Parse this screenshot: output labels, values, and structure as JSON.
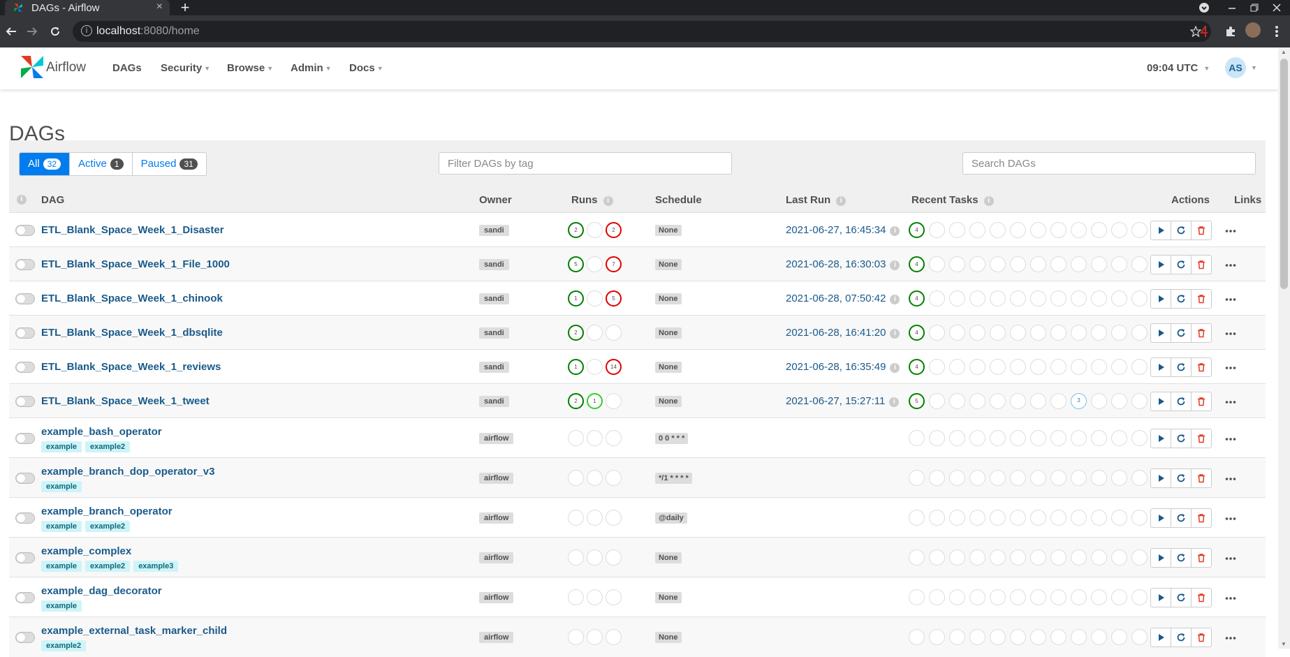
{
  "browser": {
    "tab_title": "DAGs - Airflow",
    "tab_close": "×",
    "new_tab": "+",
    "url_host": "localhost",
    "url_rest": ":8080/home"
  },
  "navbar": {
    "brand": "Airflow",
    "items": [
      {
        "label": "DAGs",
        "dropdown": false
      },
      {
        "label": "Security",
        "dropdown": true
      },
      {
        "label": "Browse",
        "dropdown": true
      },
      {
        "label": "Admin",
        "dropdown": true
      },
      {
        "label": "Docs",
        "dropdown": true
      }
    ],
    "clock": "09:04 UTC",
    "avatar": "AS"
  },
  "page": {
    "title": "DAGs",
    "filters": {
      "all_label": "All",
      "all_count": "32",
      "active_label": "Active",
      "active_count": "1",
      "paused_label": "Paused",
      "paused_count": "31"
    },
    "tag_filter_placeholder": "Filter DAGs by tag",
    "search_placeholder": "Search DAGs"
  },
  "table": {
    "headers": {
      "dag": "DAG",
      "owner": "Owner",
      "runs": "Runs",
      "schedule": "Schedule",
      "last_run": "Last Run",
      "recent_tasks": "Recent Tasks",
      "actions": "Actions",
      "links": "Links"
    },
    "rows": [
      {
        "name": "ETL_Blank_Space_Week_1_Disaster",
        "tags": [],
        "owner": "sandi",
        "runs": [
          {
            "s": "success",
            "n": "2"
          },
          {
            "s": "empty",
            "n": ""
          },
          {
            "s": "failed",
            "n": "2"
          }
        ],
        "schedule": "None",
        "last_run": "2021-06-27, 16:45:34",
        "tasks": {
          "0": {
            "s": "success",
            "n": "4"
          }
        }
      },
      {
        "name": "ETL_Blank_Space_Week_1_File_1000",
        "tags": [],
        "owner": "sandi",
        "runs": [
          {
            "s": "success",
            "n": "5"
          },
          {
            "s": "empty",
            "n": ""
          },
          {
            "s": "failed",
            "n": "7"
          }
        ],
        "schedule": "None",
        "last_run": "2021-06-28, 16:30:03",
        "tasks": {
          "0": {
            "s": "success",
            "n": "4"
          }
        }
      },
      {
        "name": "ETL_Blank_Space_Week_1_chinook",
        "tags": [],
        "owner": "sandi",
        "runs": [
          {
            "s": "success",
            "n": "1"
          },
          {
            "s": "empty",
            "n": ""
          },
          {
            "s": "failed",
            "n": "5"
          }
        ],
        "schedule": "None",
        "last_run": "2021-06-28, 07:50:42",
        "tasks": {
          "0": {
            "s": "success",
            "n": "4"
          }
        }
      },
      {
        "name": "ETL_Blank_Space_Week_1_dbsqlite",
        "tags": [],
        "owner": "sandi",
        "runs": [
          {
            "s": "success",
            "n": "2"
          },
          {
            "s": "empty",
            "n": ""
          },
          {
            "s": "empty",
            "n": ""
          }
        ],
        "schedule": "None",
        "last_run": "2021-06-28, 16:41:20",
        "tasks": {
          "0": {
            "s": "success",
            "n": "4"
          }
        }
      },
      {
        "name": "ETL_Blank_Space_Week_1_reviews",
        "tags": [],
        "owner": "sandi",
        "runs": [
          {
            "s": "success",
            "n": "1"
          },
          {
            "s": "empty",
            "n": ""
          },
          {
            "s": "failed",
            "n": "14"
          }
        ],
        "schedule": "None",
        "last_run": "2021-06-28, 16:35:49",
        "tasks": {
          "0": {
            "s": "success",
            "n": "4"
          }
        }
      },
      {
        "name": "ETL_Blank_Space_Week_1_tweet",
        "tags": [],
        "owner": "sandi",
        "runs": [
          {
            "s": "success",
            "n": "2"
          },
          {
            "s": "running",
            "n": "1"
          },
          {
            "s": "empty",
            "n": ""
          }
        ],
        "schedule": "None",
        "last_run": "2021-06-27, 15:27:11",
        "tasks": {
          "0": {
            "s": "success",
            "n": "5"
          },
          "8": {
            "s": "queued",
            "n": "3"
          }
        }
      },
      {
        "name": "example_bash_operator",
        "tags": [
          "example",
          "example2"
        ],
        "owner": "airflow",
        "runs": [
          {
            "s": "empty",
            "n": ""
          },
          {
            "s": "empty",
            "n": ""
          },
          {
            "s": "empty",
            "n": ""
          }
        ],
        "schedule": "0 0 * * *",
        "last_run": "",
        "tasks": {}
      },
      {
        "name": "example_branch_dop_operator_v3",
        "tags": [
          "example"
        ],
        "owner": "airflow",
        "runs": [
          {
            "s": "empty",
            "n": ""
          },
          {
            "s": "empty",
            "n": ""
          },
          {
            "s": "empty",
            "n": ""
          }
        ],
        "schedule": "*/1 * * * *",
        "last_run": "",
        "tasks": {}
      },
      {
        "name": "example_branch_operator",
        "tags": [
          "example",
          "example2"
        ],
        "owner": "airflow",
        "runs": [
          {
            "s": "empty",
            "n": ""
          },
          {
            "s": "empty",
            "n": ""
          },
          {
            "s": "empty",
            "n": ""
          }
        ],
        "schedule": "@daily",
        "last_run": "",
        "tasks": {}
      },
      {
        "name": "example_complex",
        "tags": [
          "example",
          "example2",
          "example3"
        ],
        "owner": "airflow",
        "runs": [
          {
            "s": "empty",
            "n": ""
          },
          {
            "s": "empty",
            "n": ""
          },
          {
            "s": "empty",
            "n": ""
          }
        ],
        "schedule": "None",
        "last_run": "",
        "tasks": {}
      },
      {
        "name": "example_dag_decorator",
        "tags": [
          "example"
        ],
        "owner": "airflow",
        "runs": [
          {
            "s": "empty",
            "n": ""
          },
          {
            "s": "empty",
            "n": ""
          },
          {
            "s": "empty",
            "n": ""
          }
        ],
        "schedule": "None",
        "last_run": "",
        "tasks": {}
      },
      {
        "name": "example_external_task_marker_child",
        "tags": [
          "example2"
        ],
        "owner": "airflow",
        "runs": [
          {
            "s": "empty",
            "n": ""
          },
          {
            "s": "empty",
            "n": ""
          },
          {
            "s": "empty",
            "n": ""
          }
        ],
        "schedule": "None",
        "last_run": "",
        "tasks": {}
      }
    ]
  },
  "colors": {
    "primary": "#017cee",
    "success": "#008000",
    "failed": "#e00000",
    "running": "#32cd32",
    "queued": "#7fbfe8",
    "delete": "#e43921",
    "dag_link": "#1a5a8a"
  },
  "icons": {
    "trigger": "play-icon",
    "refresh": "refresh-icon",
    "delete": "trash-icon",
    "links": "ellipsis-icon",
    "info": "info-icon"
  }
}
